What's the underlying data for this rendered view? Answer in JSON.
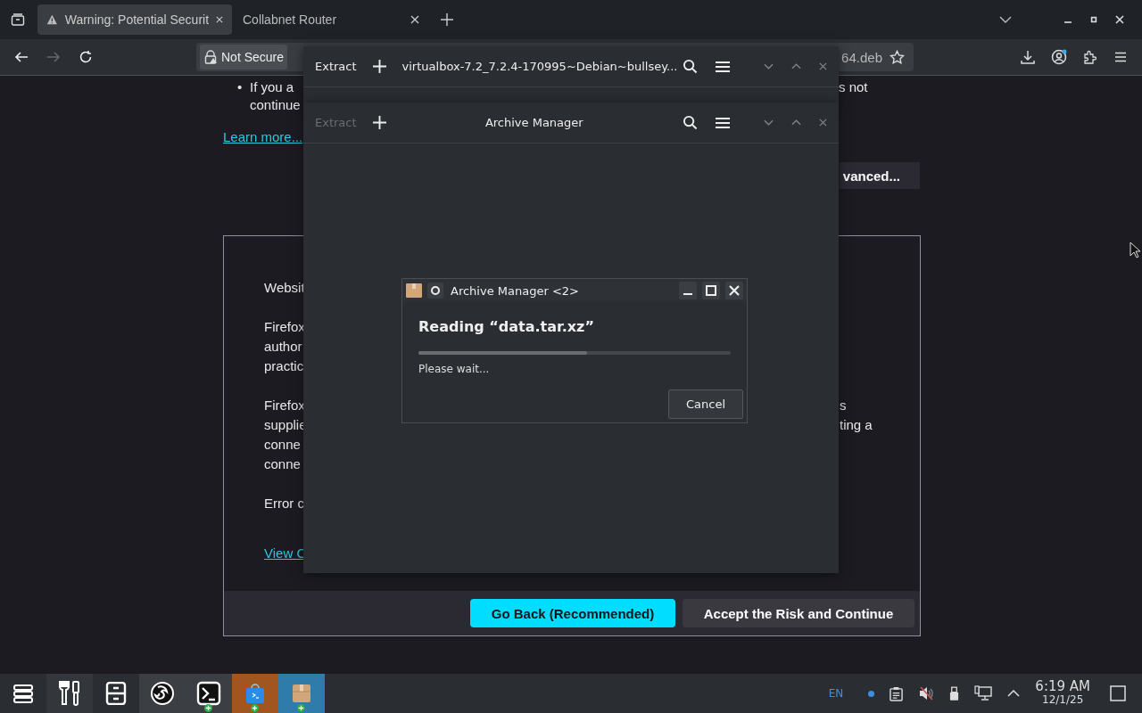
{
  "browser": {
    "tabs": [
      {
        "title": "Warning: Potential Securit",
        "selected": true,
        "kind": "warning"
      },
      {
        "title": "Collabnet Router",
        "selected": false,
        "kind": "plain"
      }
    ],
    "nav": {
      "back_disabled": false,
      "forward_disabled": true,
      "security": "Not Secure",
      "url_fragment": "64.deb",
      "account_badge": true
    },
    "page": {
      "bullet": "•",
      "bullet_lines": [
        {
          "left": "If you a",
          "right": "s not"
        },
        {
          "left": "continue"
        }
      ],
      "learn_more": "Learn more...",
      "advanced": "vanced...",
      "details": [
        {
          "left": "Websit"
        },
        {
          "left": "Firefox"
        },
        {
          "left": "author"
        },
        {
          "left": "practic"
        },
        {
          "left": "Firefox",
          "right": "s"
        },
        {
          "left": "supplie",
          "right": "ting a"
        },
        {
          "left": "conne"
        },
        {
          "left": "conne"
        },
        {
          "left": "Error c"
        }
      ],
      "view_link": "View C",
      "go_back": "Go Back (Recommended)",
      "accept": "Accept the Risk and Continue"
    }
  },
  "archive_windows": [
    {
      "extract": "Extract",
      "extract_disabled": false,
      "title": "virtualbox-7.2_7.2.4-170995~Debian~bullsey..."
    },
    {
      "extract": "Extract",
      "extract_disabled": true,
      "title": "Archive Manager"
    }
  ],
  "dialog": {
    "title": "Archive Manager <2>",
    "heading": "Reading “data.tar.xz”",
    "level": 0.54,
    "status": "Please wait...",
    "cancel": "Cancel"
  },
  "taskbar": {
    "apps": [
      {
        "kind": "menu",
        "color": "#2a2d32",
        "badge": false
      },
      {
        "kind": "tools",
        "color": "#33363b",
        "badge": false
      },
      {
        "kind": "cabinet",
        "color": "#2a2d32",
        "badge": false
      },
      {
        "kind": "browser",
        "color": "#3b3e43",
        "badge": false
      },
      {
        "kind": "terminal",
        "color": "#3b3e43",
        "badge": true
      },
      {
        "kind": "store",
        "color": "#a0561e",
        "badge": true
      },
      {
        "kind": "package",
        "color": "#2f7cab",
        "badge": true
      }
    ],
    "language": "EN",
    "time": "6:19 AM",
    "date": "12/1/25"
  }
}
